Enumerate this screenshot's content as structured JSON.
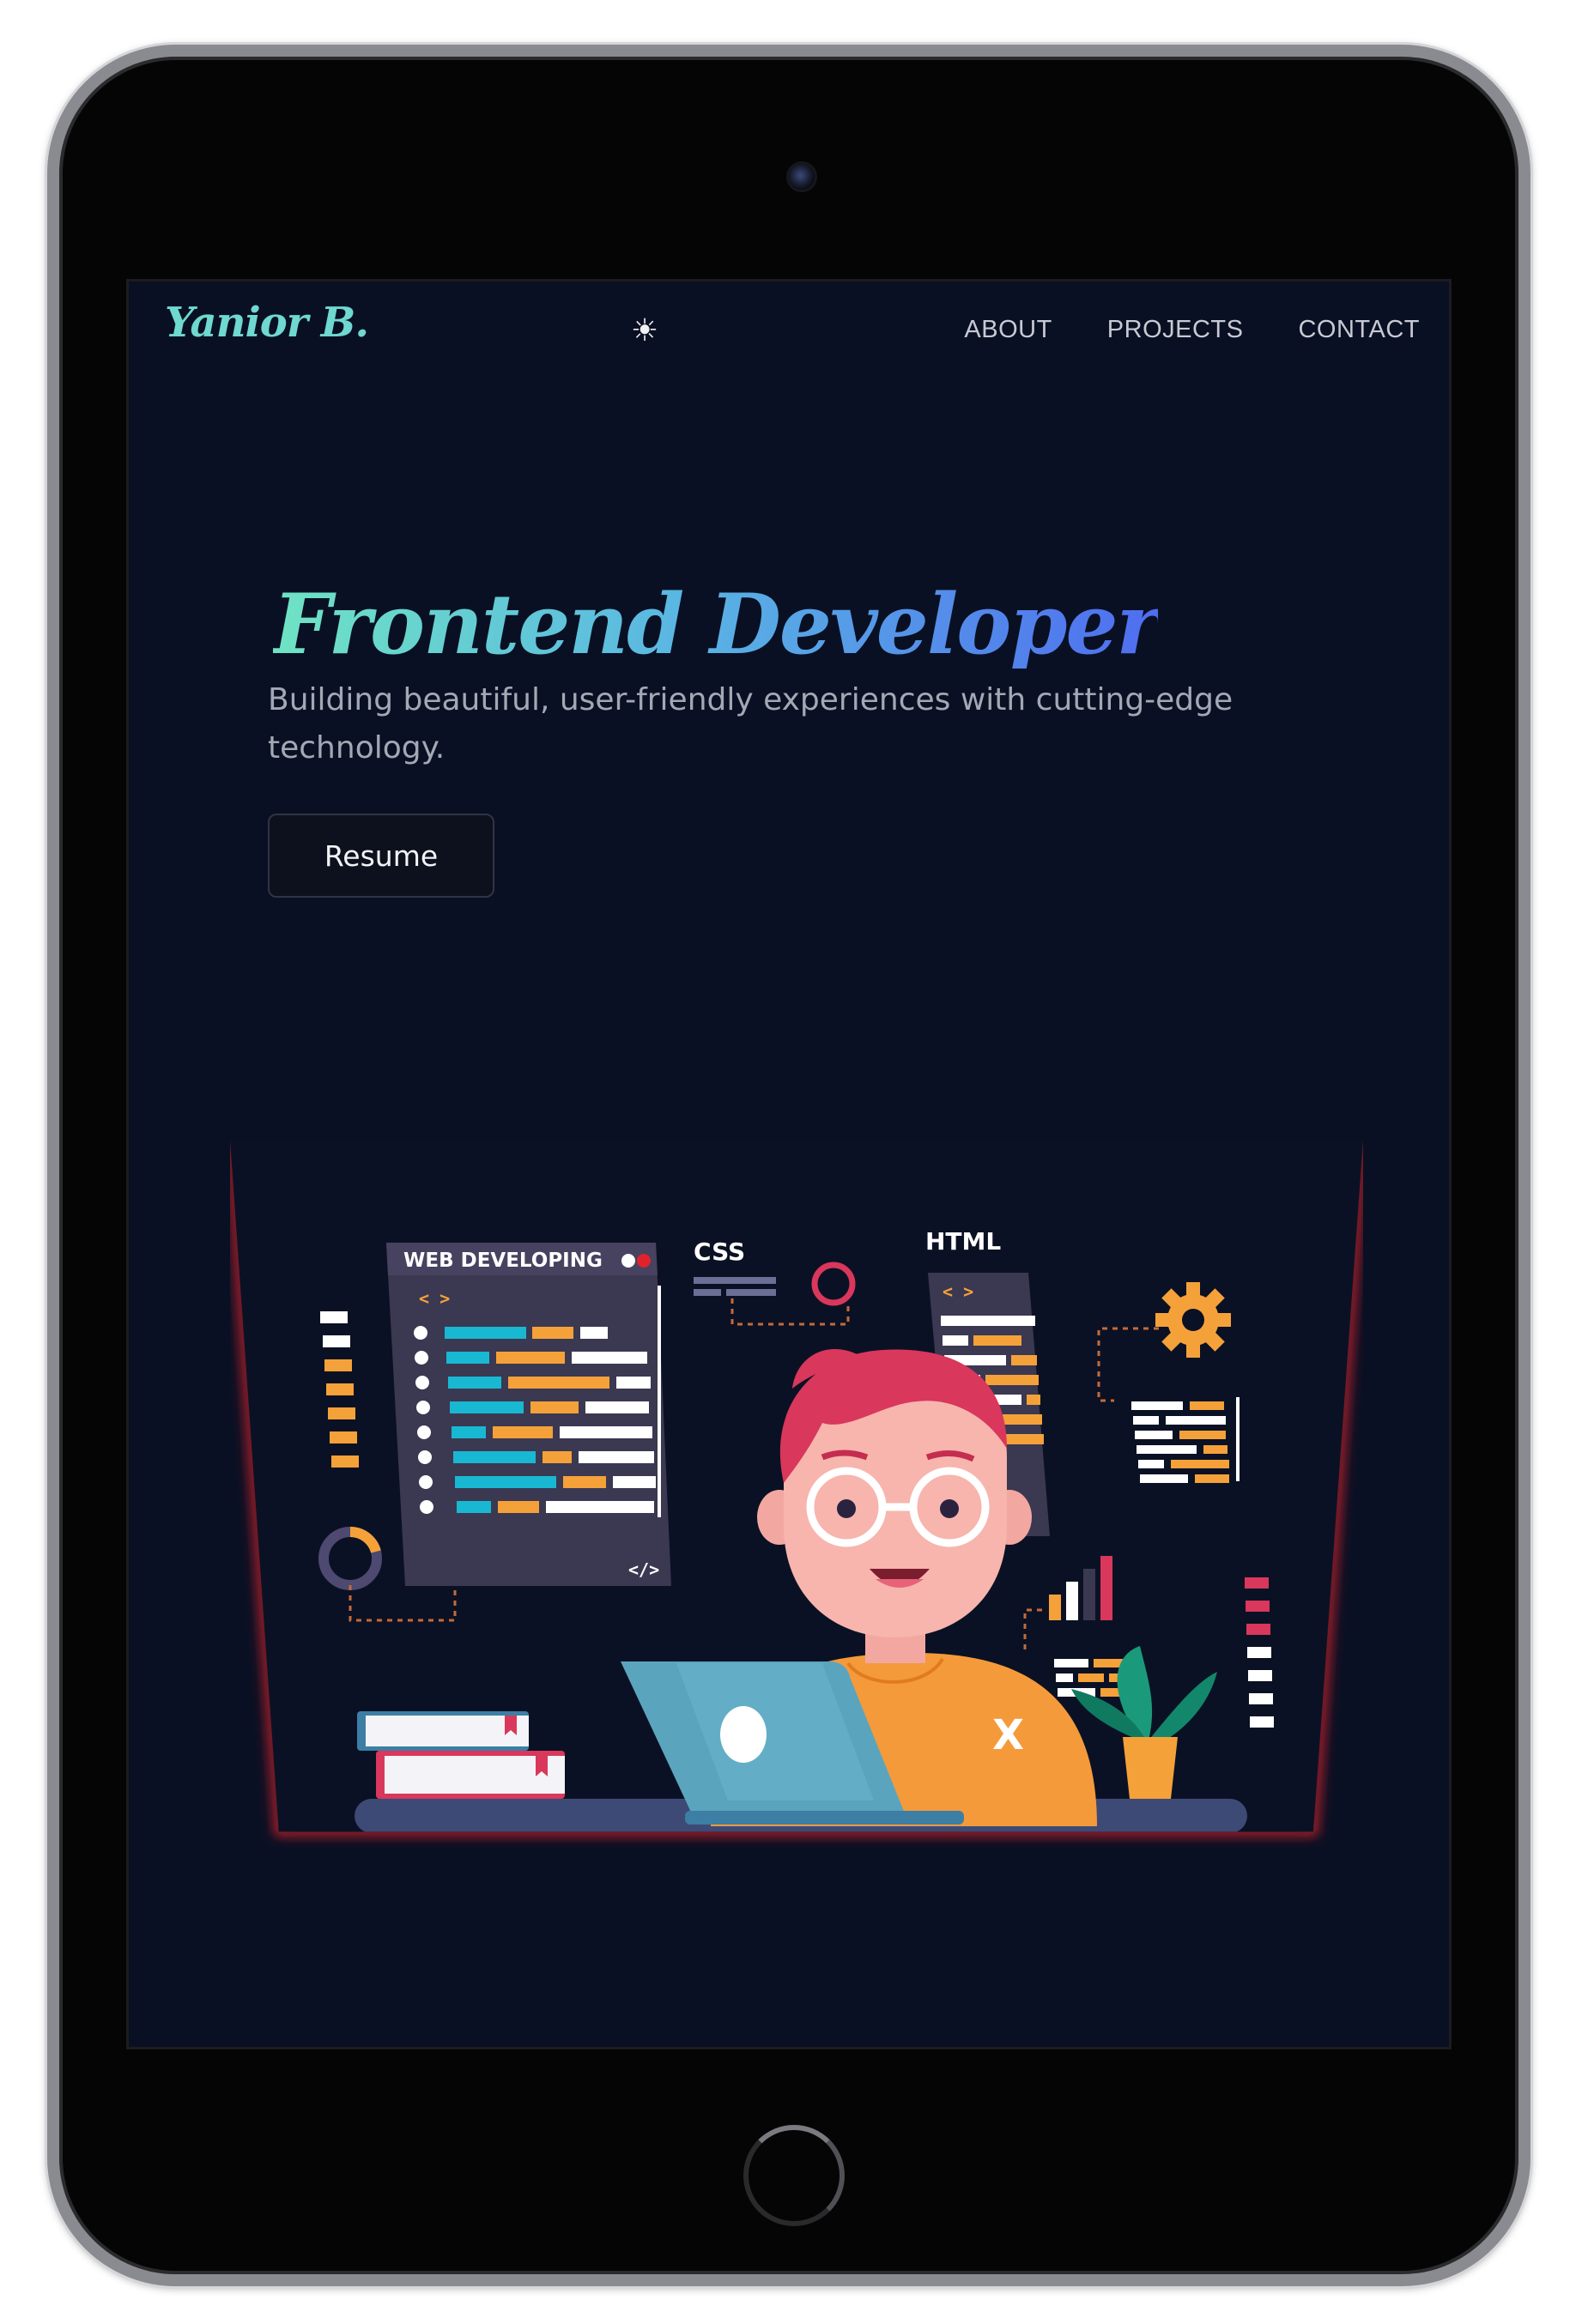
{
  "navbar": {
    "logo": "Yanior B.",
    "theme_toggle_icon": "sun-icon",
    "links": [
      "ABOUT",
      "PROJECTS",
      "CONTACT"
    ]
  },
  "hero": {
    "title": "Frontend Developer",
    "subtitle": "Building beautiful, user-friendly experiences with cutting-edge technology.",
    "resume_label": "Resume"
  },
  "illustration": {
    "panel_left_title": "WEB DEVELOPING",
    "label_css": "CSS",
    "label_html": "HTML",
    "code_tag_open": "< >",
    "code_tag_close": "</>",
    "shirt_mark": "X"
  },
  "colors": {
    "background": "#0a1023",
    "accent_teal": "#6fd8d1",
    "accent_blue": "#4f6df0",
    "glow_red": "#e0232b",
    "shirt_orange": "#f59a3a",
    "hair_pink": "#d9375b",
    "laptop_blue": "#5aa5bd",
    "code_cyan": "#19b8d2",
    "code_orange": "#f5a13a"
  }
}
